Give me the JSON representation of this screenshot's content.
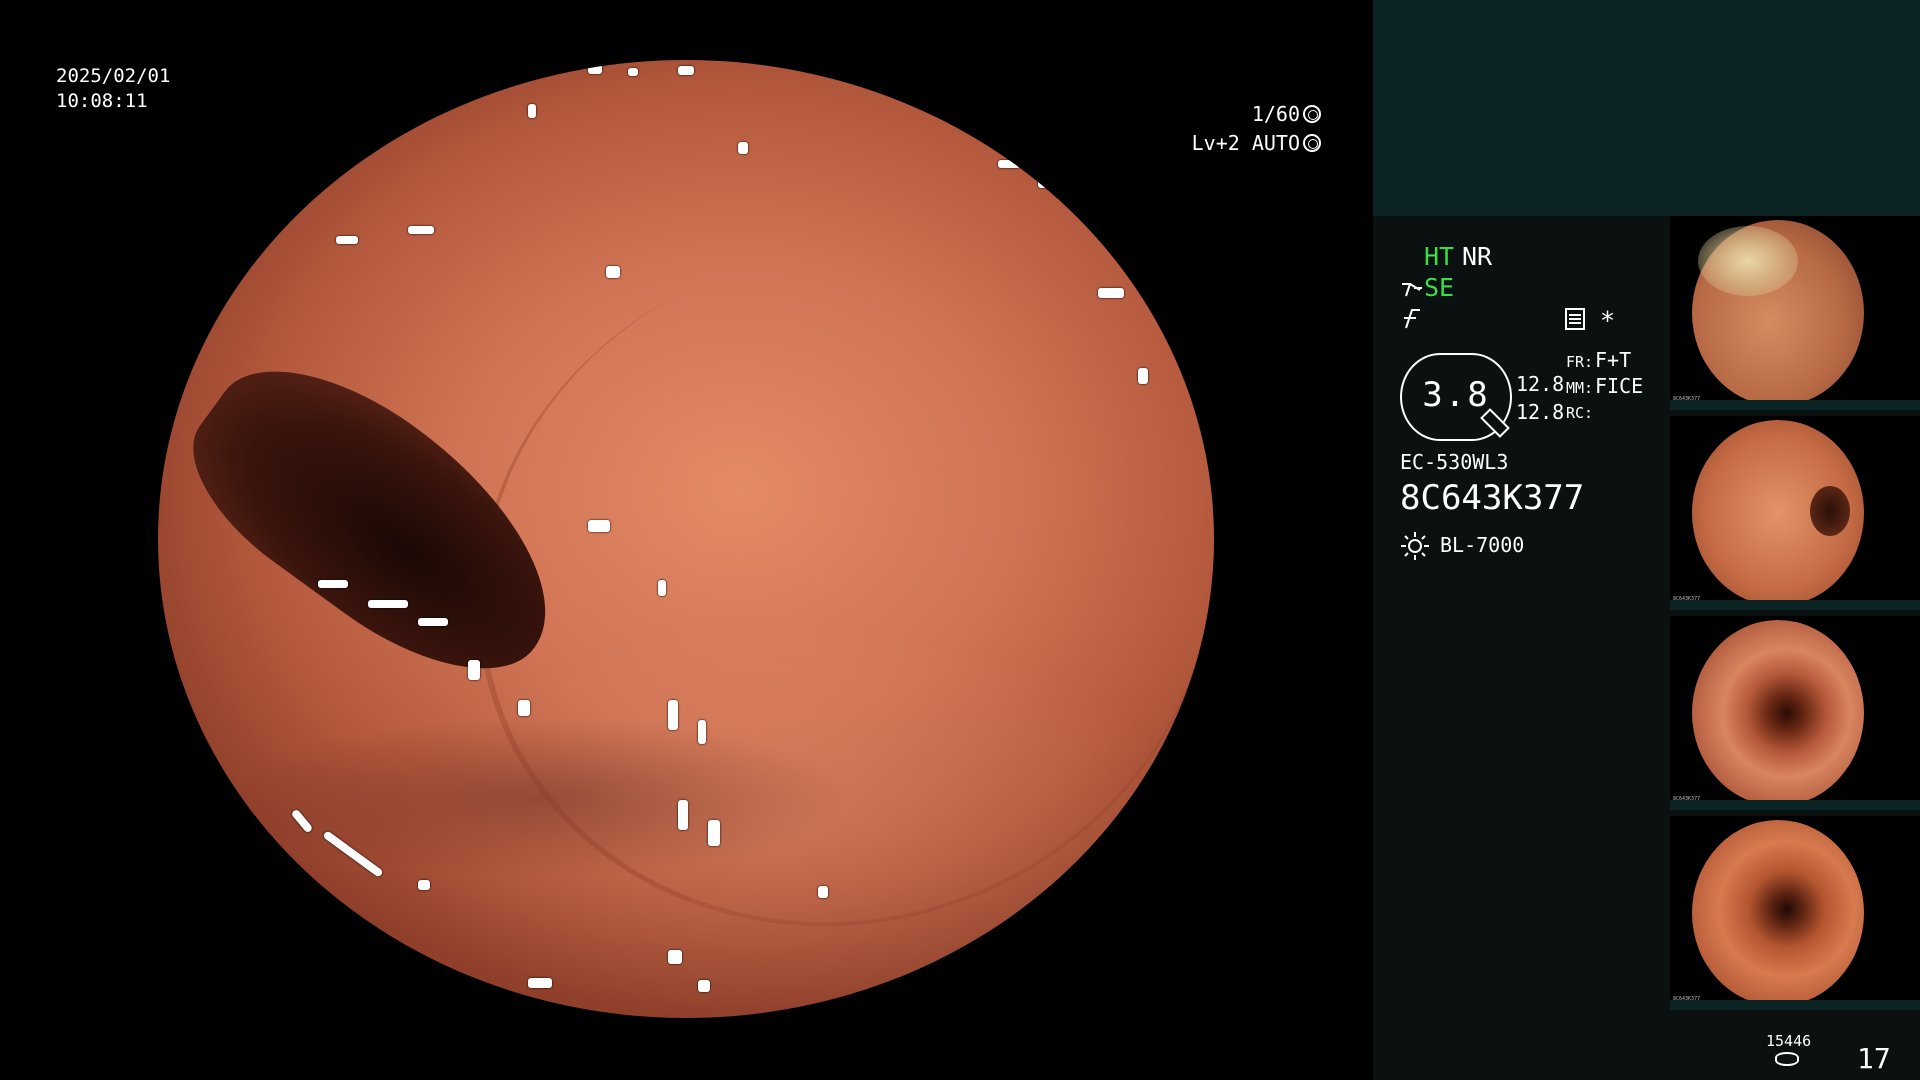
{
  "overlay": {
    "date": "2025/02/01",
    "time": "10:08:11",
    "shutter": "1/60",
    "iris": "Lv+2 AUTO"
  },
  "status": {
    "ht": "HT",
    "nr": "NR",
    "se": "SE",
    "star": "*",
    "zoom": "3.8",
    "val_a": "12.8",
    "val_b": "12.8",
    "fr_label": "FR:",
    "fr_value": "F+T",
    "mm_label": "MM:",
    "mm_value": "FICE",
    "rc_label": "RC:",
    "scope_model": "EC-530WL3",
    "scope_serial": "8C643K377",
    "light_source": "BL-7000"
  },
  "footer": {
    "image_count": "15446",
    "page": "17"
  },
  "thumbnails": [
    {
      "serial": "8C643K377"
    },
    {
      "serial": "8C643K377"
    },
    {
      "serial": "8C643K377"
    },
    {
      "serial": "8C643K377"
    }
  ],
  "colors": {
    "status_green": "#3ddc48",
    "panel_top": "#0b2423",
    "panel": "#0a1110"
  }
}
